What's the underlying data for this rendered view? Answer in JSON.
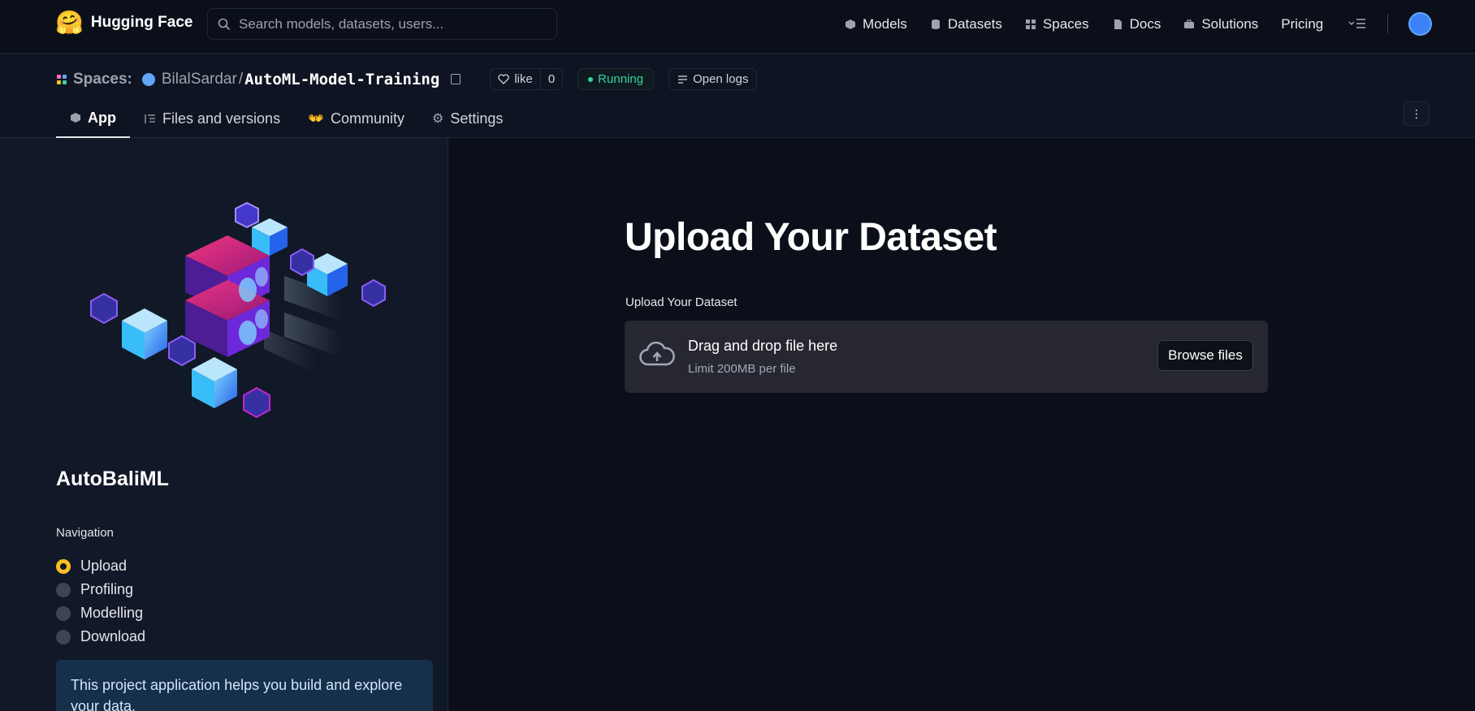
{
  "topnav": {
    "brand": "Hugging Face",
    "search_placeholder": "Search models, datasets, users...",
    "links": [
      "Models",
      "Datasets",
      "Spaces",
      "Docs",
      "Solutions",
      "Pricing"
    ]
  },
  "repo": {
    "section": "Spaces:",
    "owner": "BilalSardar",
    "slash": "/",
    "name": "AutoML-Model-Training",
    "like_label": "like",
    "like_count": "0",
    "status": "Running",
    "logs_label": "Open logs"
  },
  "tabs": [
    "App",
    "Files and versions",
    "Community",
    "Settings"
  ],
  "sidebar": {
    "title": "AutoBaliML",
    "nav_label": "Navigation",
    "options": [
      "Upload",
      "Profiling",
      "Modelling",
      "Download"
    ],
    "selected": "Upload",
    "info": "This project application helps you build and explore your data."
  },
  "main": {
    "heading": "Upload Your Dataset",
    "uploader_label": "Upload Your Dataset",
    "dropzone_text": "Drag and drop file here",
    "dropzone_limit": "Limit 200MB per file",
    "browse_label": "Browse files"
  },
  "colors": {
    "background": "#0b0f19",
    "running": "#34d399",
    "radio_selected": "#fbbf24",
    "info_bg": "#17304a"
  }
}
